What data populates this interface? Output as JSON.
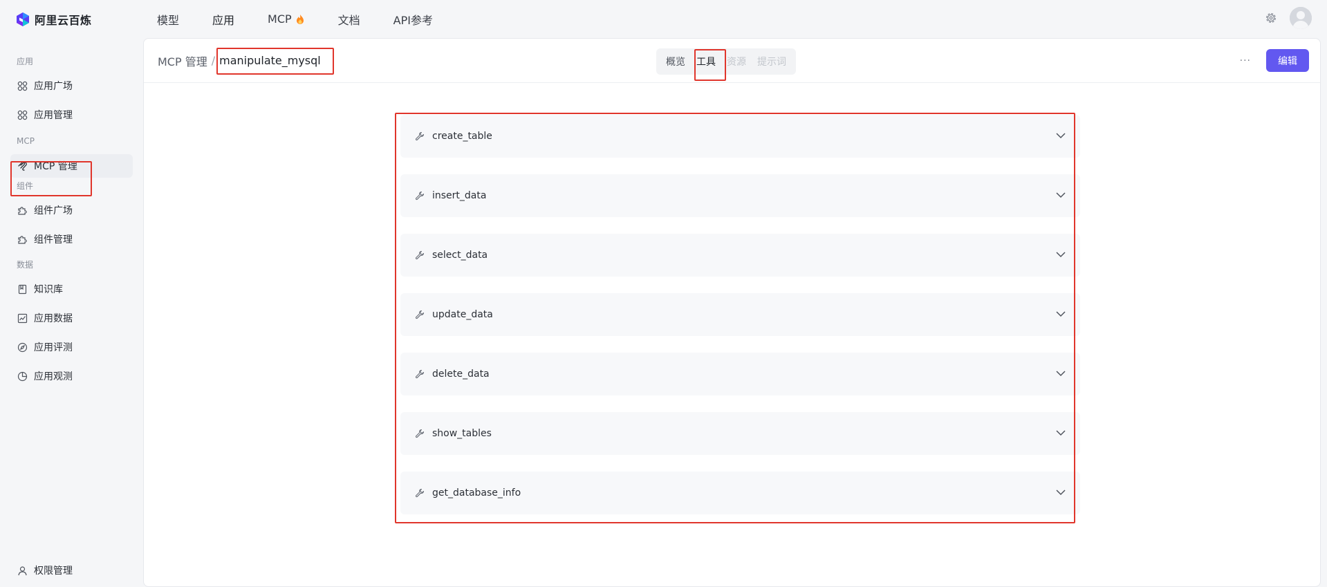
{
  "brand": {
    "name": "阿里云百炼"
  },
  "topnav": [
    {
      "label": "模型"
    },
    {
      "label": "应用"
    },
    {
      "label": "MCP"
    },
    {
      "label": "文档"
    },
    {
      "label": "API参考"
    }
  ],
  "sidebar": {
    "sections": {
      "app": "应用",
      "mcp": "MCP",
      "component": "组件",
      "data": "数据"
    },
    "items": {
      "app_square": "应用广场",
      "app_manage": "应用管理",
      "mcp_manage": "MCP 管理",
      "comp_square": "组件广场",
      "comp_manage": "组件管理",
      "knowledge": "知识库",
      "app_data": "应用数据",
      "app_eval": "应用评测",
      "app_observe": "应用观测",
      "permission": "权限管理"
    }
  },
  "header": {
    "breadcrumb_parent": "MCP 管理",
    "breadcrumb_sep": "/",
    "breadcrumb_current": "manipulate_mysql",
    "tabs": [
      {
        "label": "概览"
      },
      {
        "label": "工具"
      },
      {
        "label": "资源"
      },
      {
        "label": "提示词"
      }
    ],
    "more": "···",
    "edit_label": "编辑"
  },
  "tools": [
    {
      "name": "create_table"
    },
    {
      "name": "insert_data"
    },
    {
      "name": "select_data"
    },
    {
      "name": "update_data"
    },
    {
      "name": "delete_data"
    },
    {
      "name": "show_tables"
    },
    {
      "name": "get_database_info"
    }
  ],
  "colors": {
    "accent": "#6258f0",
    "annotation": "#e0352b",
    "sidebar_active": "#eceef2"
  }
}
